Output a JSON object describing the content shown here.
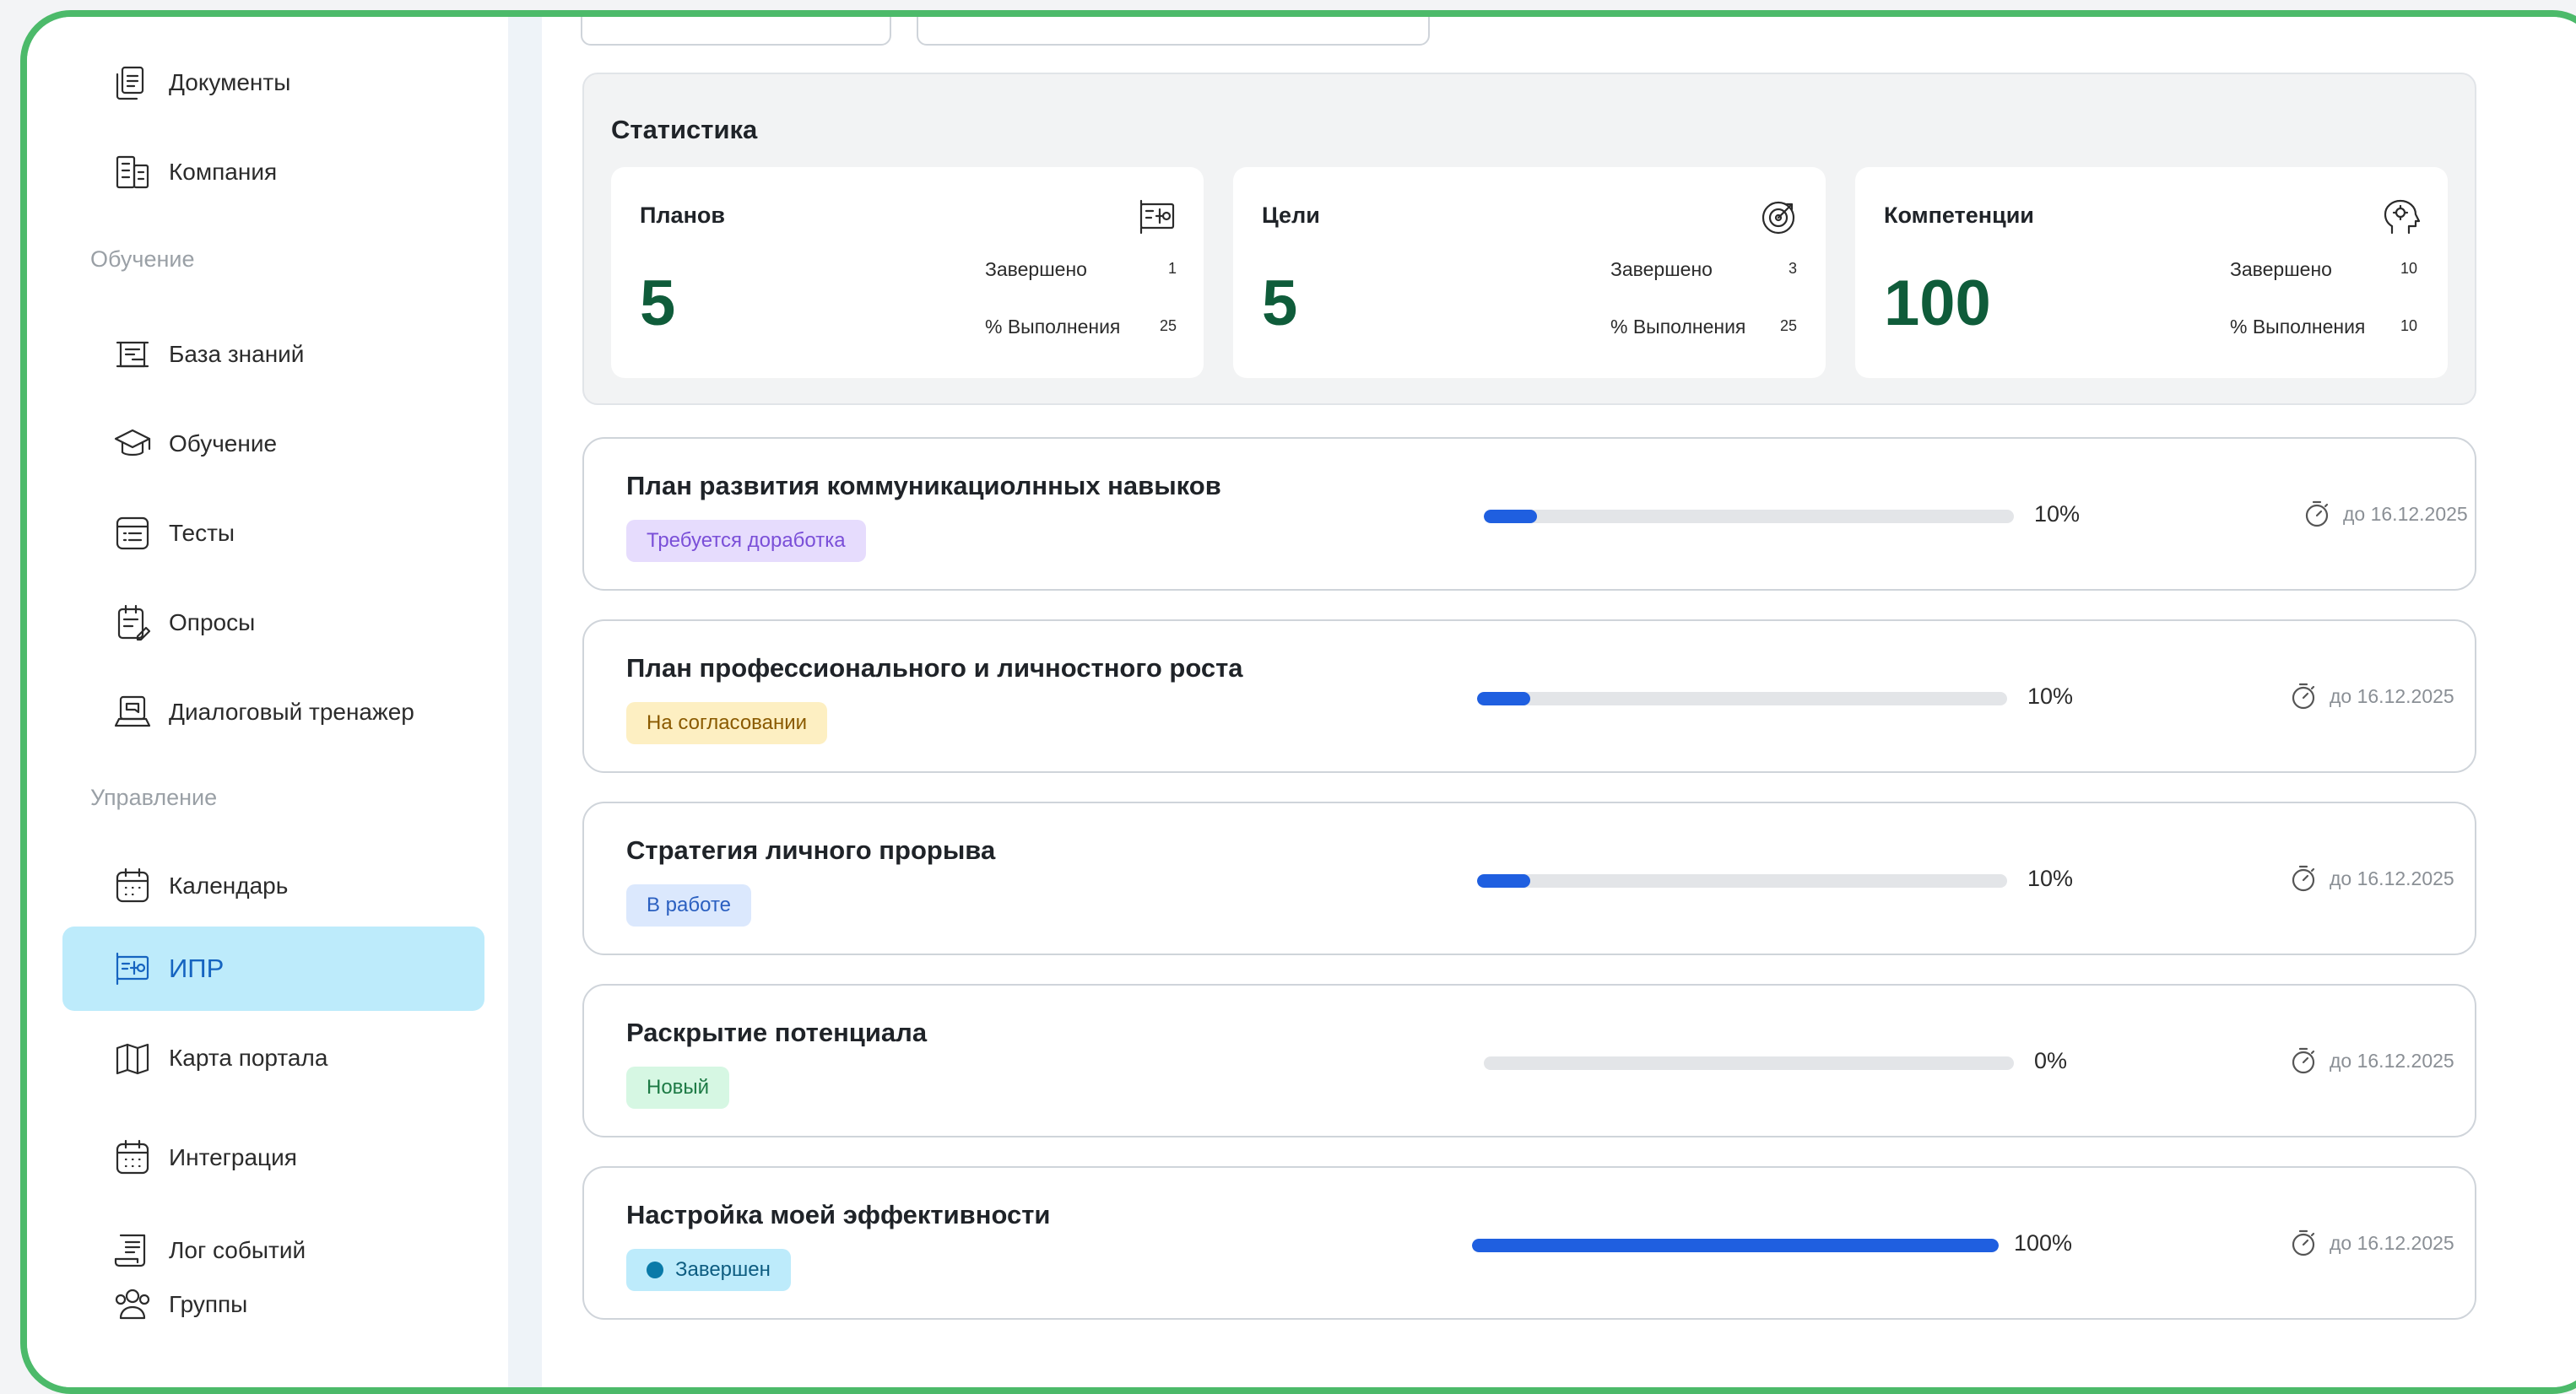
{
  "sidebar": {
    "items_top": [
      {
        "label": "Документы",
        "icon": "documents-icon"
      },
      {
        "label": "Компания",
        "icon": "company-icon"
      }
    ],
    "section_learning": "Обучение",
    "items_learning": [
      {
        "label": "База знаний",
        "icon": "knowledge-base-icon"
      },
      {
        "label": "Обучение",
        "icon": "graduation-cap-icon"
      },
      {
        "label": "Тесты",
        "icon": "tests-icon"
      },
      {
        "label": "Опросы",
        "icon": "survey-icon"
      },
      {
        "label": "Диалоговый тренажер",
        "icon": "dialog-trainer-icon"
      }
    ],
    "section_management": "Управление",
    "items_management": [
      {
        "label": "Календарь",
        "icon": "calendar-icon"
      },
      {
        "label": "ИПР",
        "icon": "ipr-icon",
        "active": true
      },
      {
        "label": "Карта портала",
        "icon": "map-icon"
      },
      {
        "label": "Интеграция",
        "icon": "integration-icon"
      },
      {
        "label": "Лог событий",
        "icon": "event-log-icon"
      },
      {
        "label": "Группы",
        "icon": "groups-icon"
      }
    ]
  },
  "stats": {
    "title": "Статистика",
    "cards": [
      {
        "title": "Планов",
        "icon": "plan-board-icon",
        "value": "5",
        "completed_label": "Завершено",
        "completed_value": "1",
        "percent_label": "% Выполнения",
        "percent_value": "25"
      },
      {
        "title": "Цели",
        "icon": "target-icon",
        "value": "5",
        "completed_label": "Завершено",
        "completed_value": "3",
        "percent_label": "% Выполнения",
        "percent_value": "25"
      },
      {
        "title": "Компетенции",
        "icon": "head-gears-icon",
        "value": "100",
        "completed_label": "Завершено",
        "completed_value": "10",
        "percent_label": "% Выполнения",
        "percent_value": "10"
      }
    ]
  },
  "plans": [
    {
      "title": "План развития коммуникациолнных навыков",
      "status": "Требуется доработка",
      "status_bg": "#e6dcfd",
      "status_color": "#7a4fd8",
      "progress": 10,
      "progress_label": "10%",
      "due": "до 16.12.2025"
    },
    {
      "title": "План профессионального и личностного роста",
      "status": "На согласовании",
      "status_bg": "#fdefc2",
      "status_color": "#8a5a00",
      "progress": 10,
      "progress_label": "10%",
      "due": "до 16.12.2025"
    },
    {
      "title": "Стратегия личного прорыва",
      "status": "В работе",
      "status_bg": "#dbe8fd",
      "status_color": "#2a5fc0",
      "progress": 10,
      "progress_label": "10%",
      "due": "до 16.12.2025"
    },
    {
      "title": "Раскрытие потенциала",
      "status": "Новый",
      "status_bg": "#d6f7e3",
      "status_color": "#1d7a45",
      "progress": 0,
      "progress_label": "0%",
      "due": "до 16.12.2025"
    },
    {
      "title": "Настройка моей эффективности",
      "status": "Завершен",
      "status_bg": "#bdebfb",
      "status_color": "#0d5c80",
      "progress": 100,
      "progress_label": "100%",
      "due": "до 16.12.2025"
    }
  ],
  "colors": {
    "accent": "#1664c0",
    "progress": "#1f5fe0",
    "stat_value": "#0f5c3a",
    "frame": "#4cba6a"
  }
}
